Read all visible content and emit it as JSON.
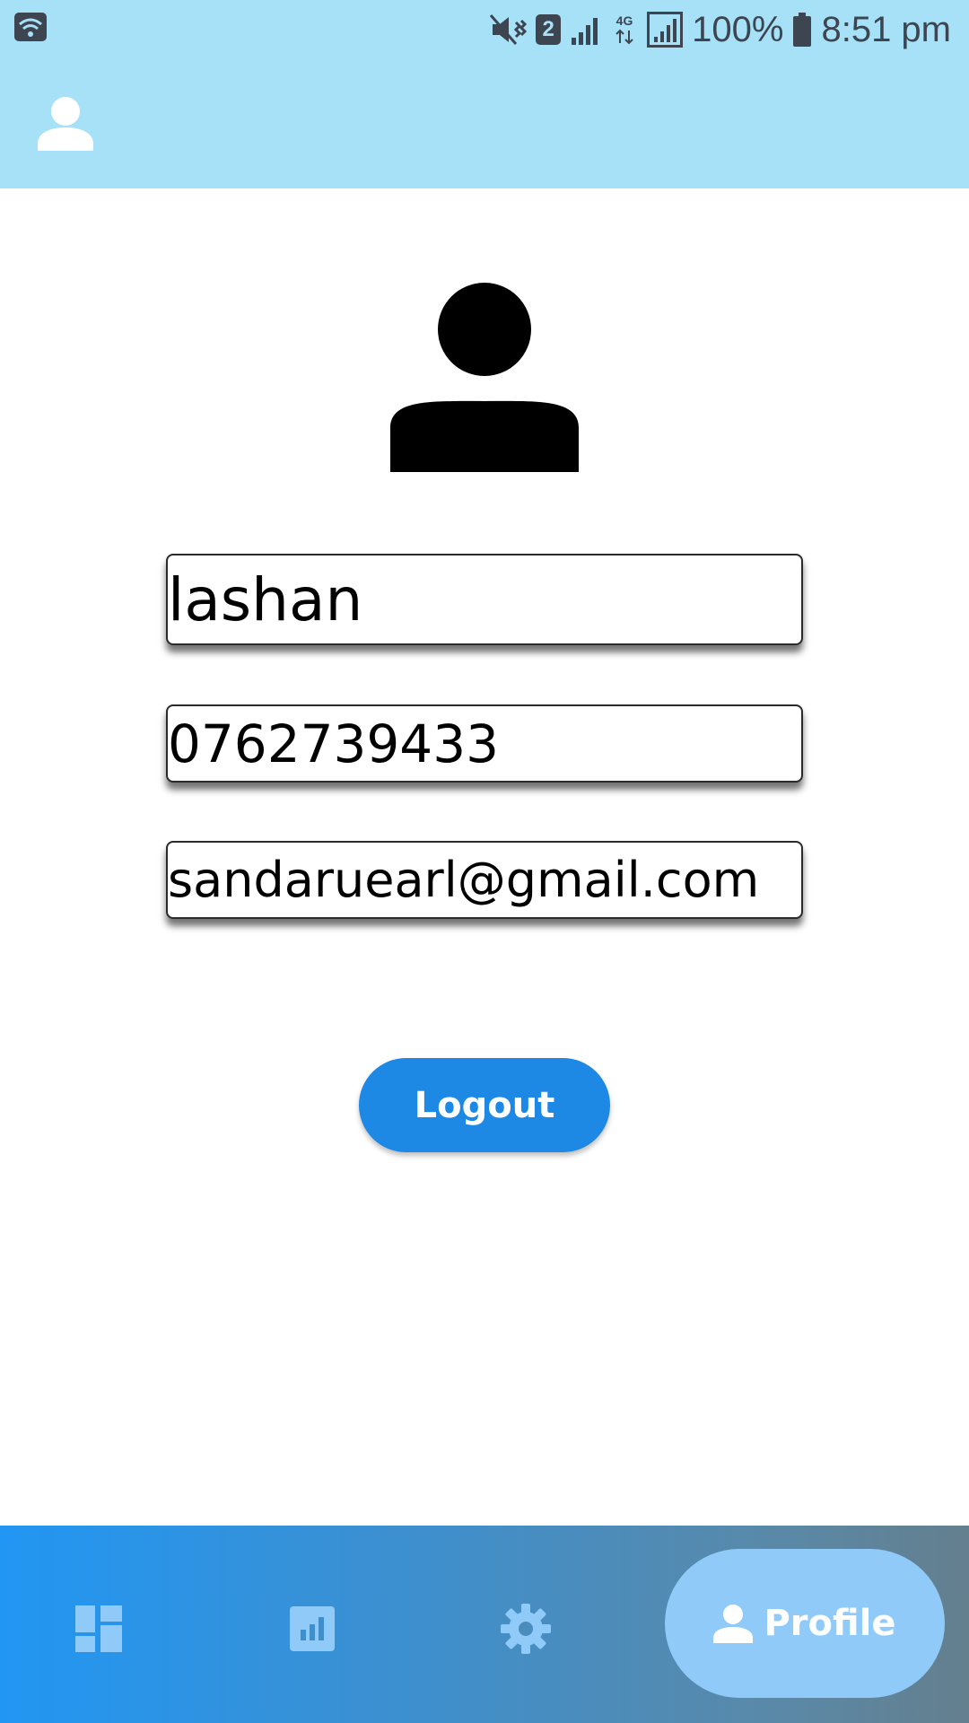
{
  "status_bar": {
    "battery_percent": "100%",
    "time": "8:51 pm",
    "sim_slot": "2",
    "network_type": "4G",
    "icons": [
      "wifi-icon",
      "mute-vibrate-icon",
      "sim-2-icon",
      "signal-icon",
      "4g-data-icon",
      "signal-full-icon",
      "battery-icon"
    ]
  },
  "app_bar": {
    "icon": "person-icon"
  },
  "profile": {
    "avatar_icon": "person-icon",
    "name": "lashan",
    "phone": "0762739433",
    "email": "sandaruearl@gmail.com"
  },
  "actions": {
    "logout_label": "Logout"
  },
  "bottom_nav": {
    "items": [
      {
        "icon": "dashboard-icon",
        "label": "",
        "active": false
      },
      {
        "icon": "bar-chart-icon",
        "label": "",
        "active": false
      },
      {
        "icon": "settings-gear-icon",
        "label": "",
        "active": false
      },
      {
        "icon": "person-icon",
        "label": "Profile",
        "active": true
      }
    ]
  },
  "colors": {
    "app_bar": "#a6e1f8",
    "primary": "#1e88e5",
    "nav_active_pill": "#90caf9",
    "nav_icon": "#90caf9"
  }
}
